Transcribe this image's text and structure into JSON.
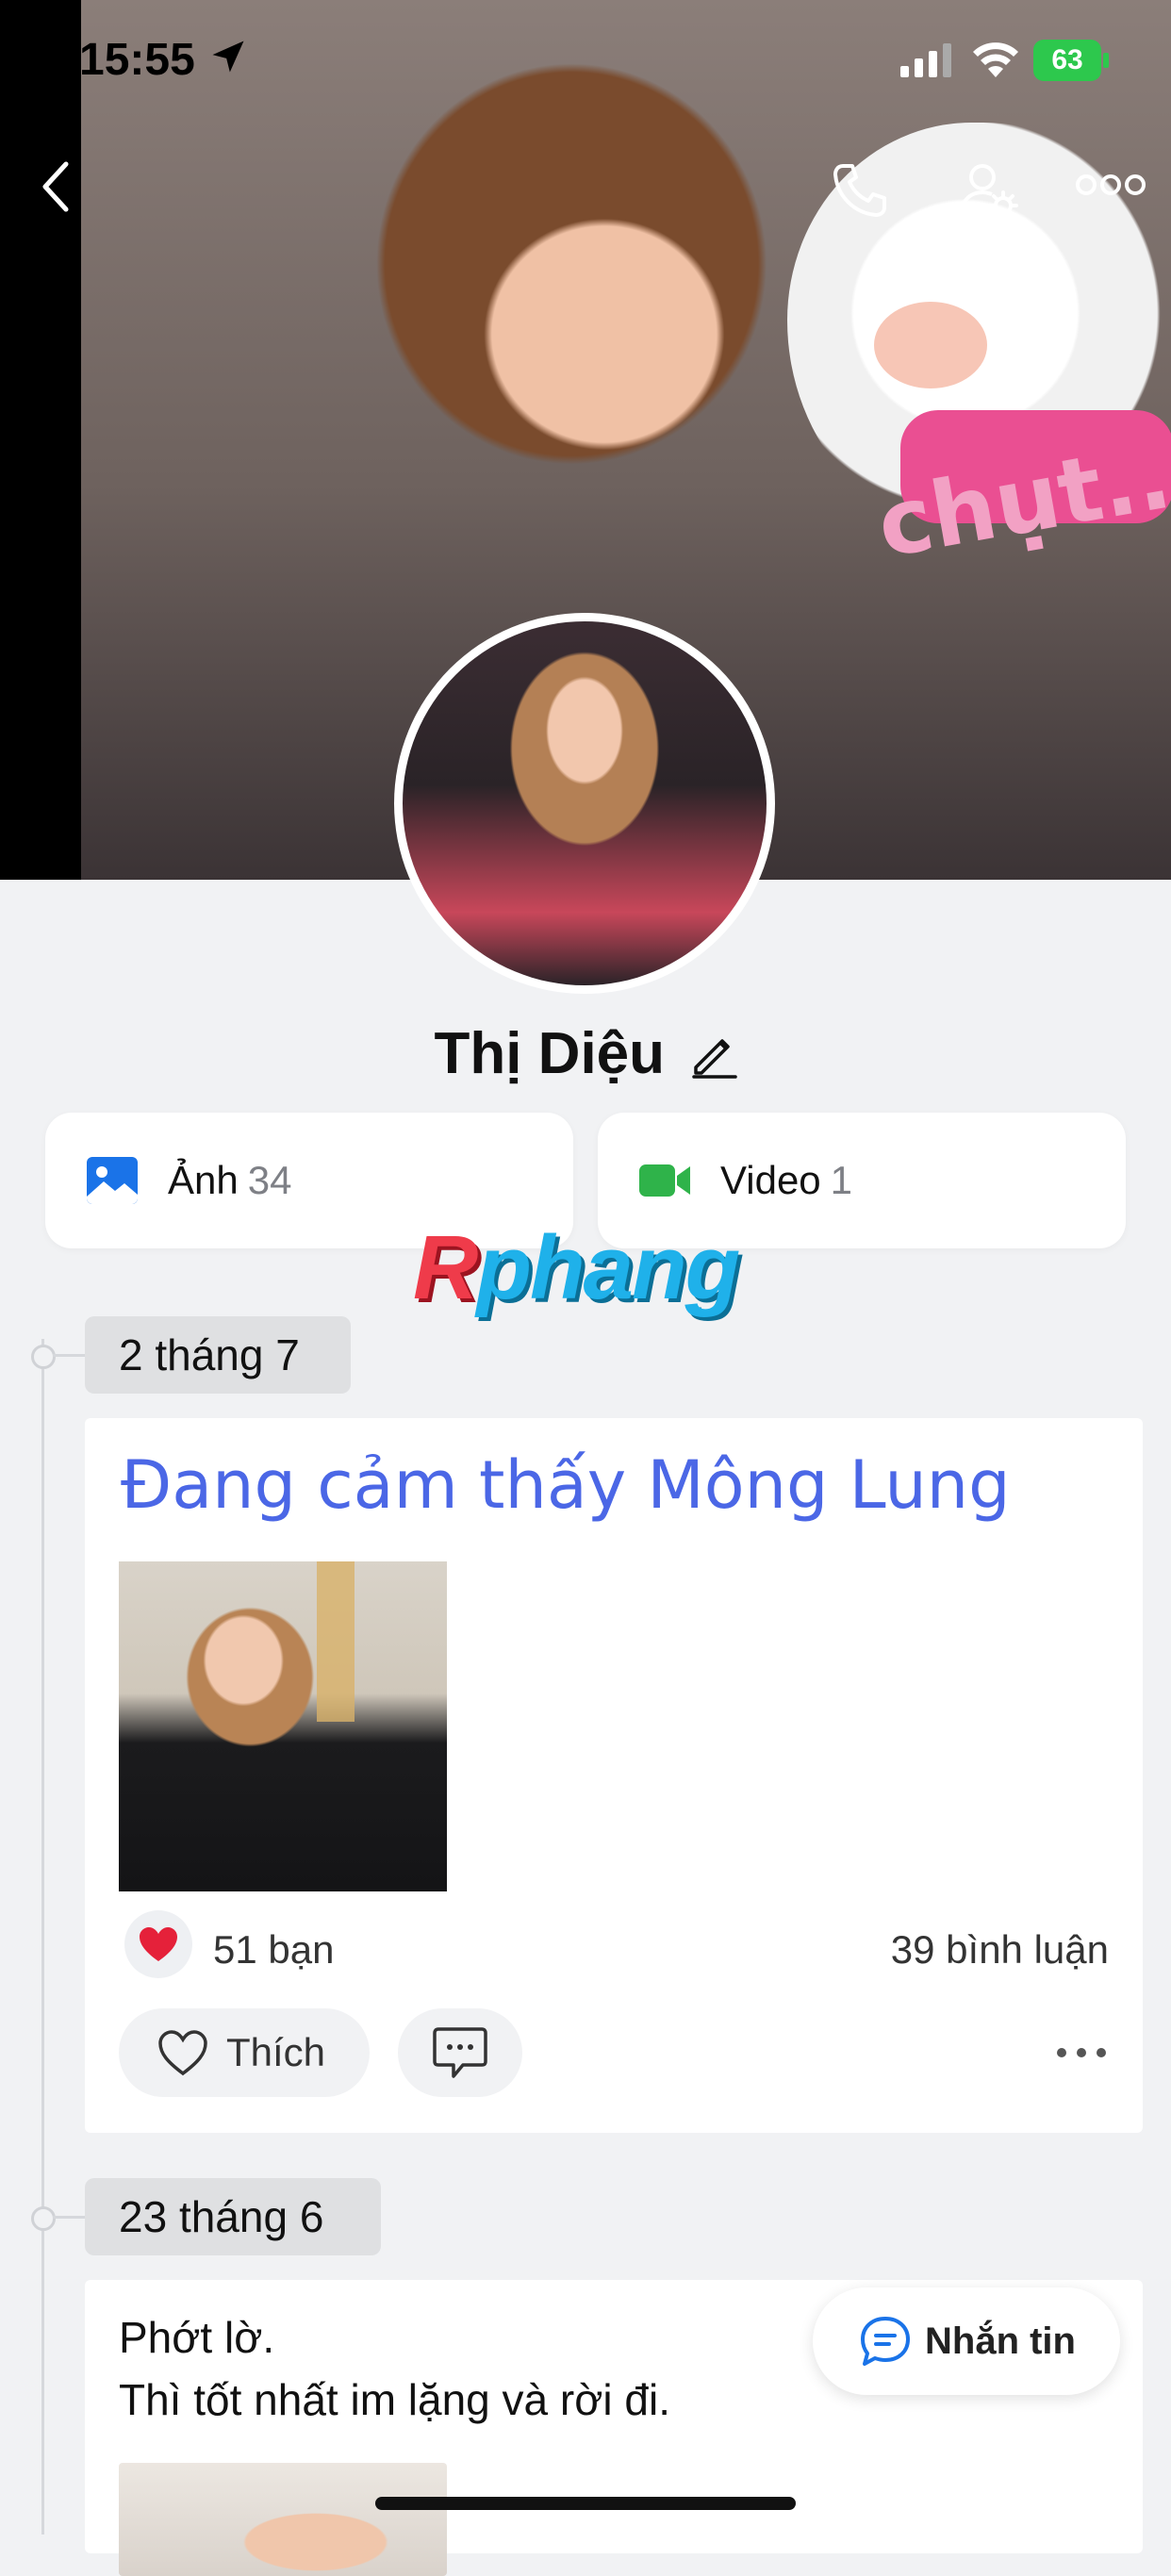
{
  "status_bar": {
    "time": "15:55",
    "battery": "63"
  },
  "profile": {
    "name": "Thị Diệu"
  },
  "media": {
    "photos": {
      "label": "Ảnh",
      "count": "34"
    },
    "videos": {
      "label": "Video",
      "count": "1"
    }
  },
  "watermark": {
    "first": "R",
    "rest": "phang"
  },
  "cover_sticker_text": "chụt..",
  "timeline": [
    {
      "date": "2 tháng 7",
      "status": "Đang cảm thấy Mông Lung",
      "reactions": "51 bạn",
      "comments": "39 bình luận",
      "like_label": "Thích"
    },
    {
      "date": "23 tháng 6",
      "text_line1": "Phớt lờ.",
      "text_line2": "Thì tốt nhất im lặng và rời đi."
    }
  ],
  "message_button": {
    "label": "Nhắn tin"
  },
  "colors": {
    "accent": "#4b67e6",
    "photo_icon": "#1a73e8",
    "video_icon": "#2fb34a",
    "heart": "#e5213a",
    "battery": "#2dc84d"
  }
}
